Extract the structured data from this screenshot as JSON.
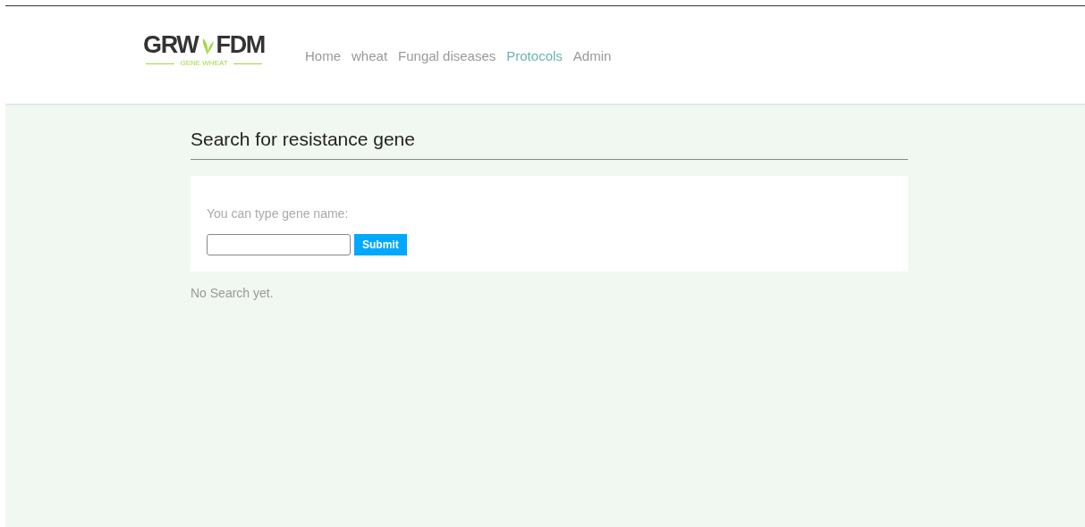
{
  "logo": {
    "left": "GRW",
    "right": "FDM",
    "tagline": "GENE WHEAT"
  },
  "nav": [
    {
      "label": "Home",
      "selected": false
    },
    {
      "label": "wheat",
      "selected": false
    },
    {
      "label": "Fungal diseases",
      "selected": false
    },
    {
      "label": "Protocols",
      "selected": true
    },
    {
      "label": "Admin",
      "selected": false
    }
  ],
  "page_title": "Search for resistance gene",
  "search": {
    "prompt": "You can type gene name:",
    "button": "Submit"
  },
  "result": "No Search yet."
}
